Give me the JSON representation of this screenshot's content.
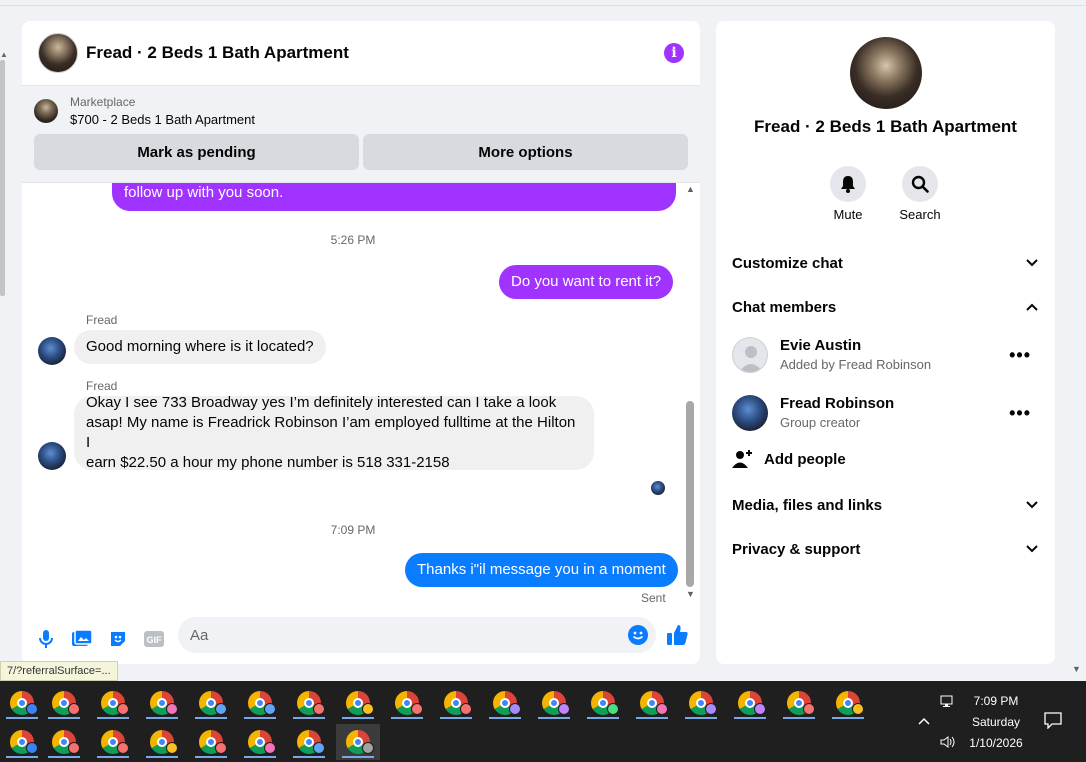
{
  "chat": {
    "title": "Fread · 2 Beds 1 Bath Apartment",
    "info_icon": "i"
  },
  "marketplace": {
    "label": "Marketplace",
    "listing": "$700 - 2 Beds 1 Bath Apartment",
    "buttons": [
      "Mark as pending",
      "More options"
    ]
  },
  "messages": {
    "partial_out": "follow up with you soon.",
    "time1": "5:26 PM",
    "out1": "Do you want to rent it?",
    "sender1": "Fread",
    "in1": "Good morning where is it located?",
    "sender2": "Fread",
    "in2_line1": "Okay I see 733 Broadway yes I’m definitely interested can I take a look",
    "in2_line2": "asap! My name is Freadrick Robinson I’am employed fulltime at the Hilton I",
    "in2_line3": "earn $22.50 a hour my phone number is 518 331-2158",
    "time2": "7:09 PM",
    "out2": "Thanks i\"il message you in a moment",
    "status": "Sent"
  },
  "composer": {
    "placeholder": "Aa",
    "value": ""
  },
  "info_panel": {
    "title": "Fread · 2 Beds 1 Bath Apartment",
    "mute_label": "Mute",
    "search_label": "Search",
    "customize": "Customize chat",
    "members_header": "Chat members",
    "members": [
      {
        "name": "Evie Austin",
        "sub": "Added by Fread Robinson"
      },
      {
        "name": "Fread Robinson",
        "sub": "Group creator"
      }
    ],
    "add_people": "Add people",
    "media": "Media, files and links",
    "privacy": "Privacy & support"
  },
  "tooltip": "7/?referralSurface=...",
  "taskbar": {
    "time": "7:09 PM",
    "day": "Saturday",
    "date": "1/10/2026"
  },
  "colors": {
    "accent_purple": "#a033ff",
    "accent_blue": "#0a7cff"
  }
}
